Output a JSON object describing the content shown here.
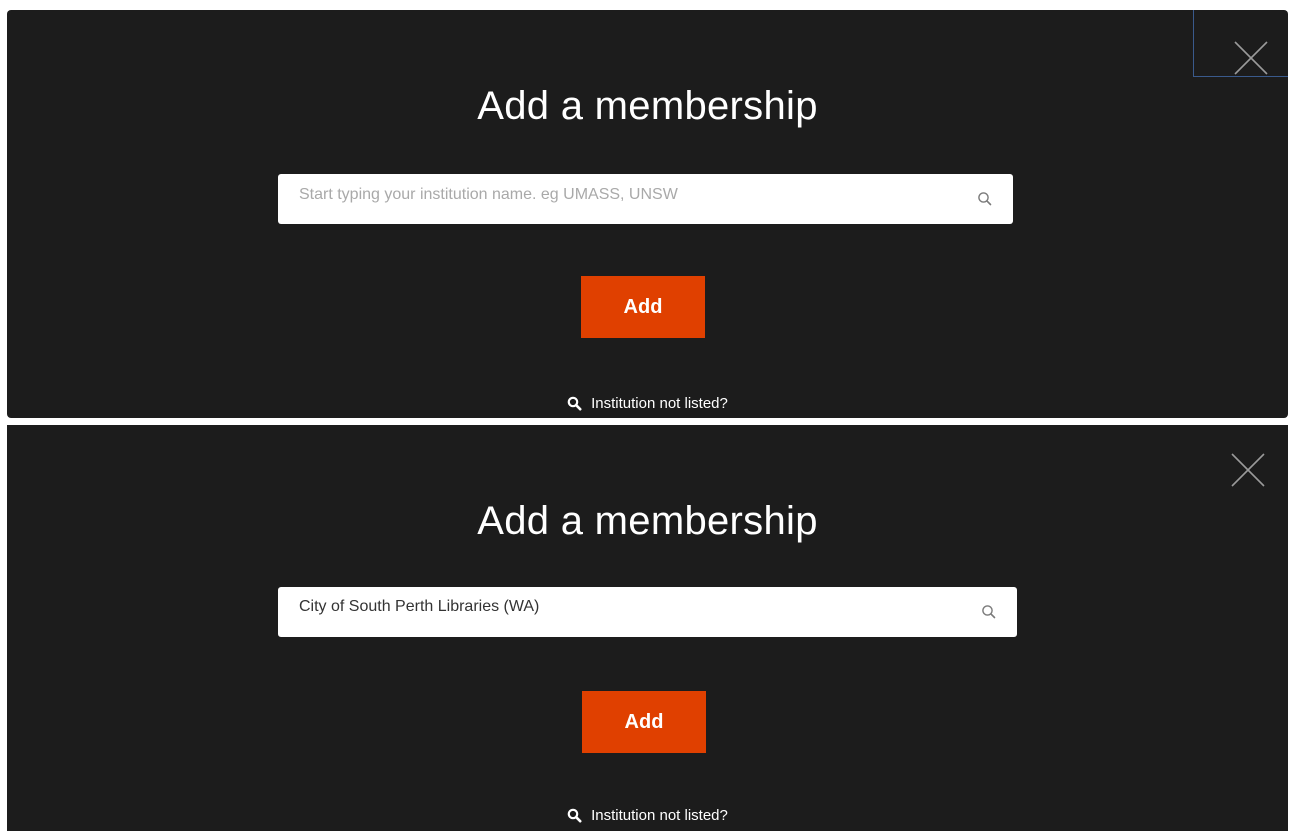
{
  "panels": [
    {
      "title": "Add a membership",
      "search": {
        "placeholder": "Start typing your institution name. eg UMASS, UNSW",
        "value": ""
      },
      "add_label": "Add",
      "not_listed_label": "Institution not listed?"
    },
    {
      "title": "Add a membership",
      "search": {
        "placeholder": "Start typing your institution name. eg UMASS, UNSW",
        "value": "City of South Perth Libraries (WA)"
      },
      "add_label": "Add",
      "not_listed_label": "Institution not listed?"
    }
  ],
  "icons": {
    "close": "close-icon",
    "search": "search-icon",
    "magnifier": "magnifier-icon"
  },
  "colors": {
    "panel_bg": "#1c1c1c",
    "accent": "#e04000",
    "text": "#ffffff",
    "focus_border": "#3a5a8c"
  }
}
